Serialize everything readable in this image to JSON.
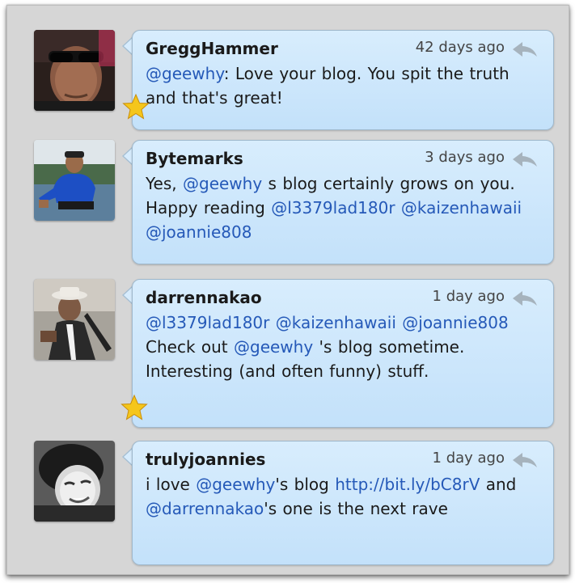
{
  "tweets": [
    {
      "username": "GreggHammer",
      "time": "42 days ago",
      "segments": [
        {
          "type": "mention",
          "text": "@geewhy"
        },
        {
          "type": "text",
          "text": ": Love your blog. You spit the truth and that's great!"
        }
      ],
      "starred": true
    },
    {
      "username": "Bytemarks",
      "time": "3 days ago",
      "segments": [
        {
          "type": "text",
          "text": "Yes, "
        },
        {
          "type": "mention",
          "text": "@geewhy"
        },
        {
          "type": "text",
          "text": " s blog certainly grows on you. Happy reading "
        },
        {
          "type": "mention",
          "text": "@l3379lad180r"
        },
        {
          "type": "text",
          "text": " "
        },
        {
          "type": "mention",
          "text": "@kaizenhawaii"
        },
        {
          "type": "text",
          "text": " "
        },
        {
          "type": "mention",
          "text": "@joannie808"
        }
      ],
      "starred": false
    },
    {
      "username": "darrennakao",
      "time": "1 day ago",
      "segments": [
        {
          "type": "mention",
          "text": "@l3379lad180r"
        },
        {
          "type": "text",
          "text": " "
        },
        {
          "type": "mention",
          "text": "@kaizenhawaii"
        },
        {
          "type": "text",
          "text": " "
        },
        {
          "type": "mention",
          "text": "@joannie808"
        },
        {
          "type": "text",
          "text": " Check out "
        },
        {
          "type": "mention",
          "text": "@geewhy"
        },
        {
          "type": "text",
          "text": " 's blog sometime. Interesting (and often funny) stuff."
        }
      ],
      "starred": true
    },
    {
      "username": "trulyjoannies",
      "time": "1 day ago",
      "segments": [
        {
          "type": "text",
          "text": "i love "
        },
        {
          "type": "mention",
          "text": "@geewhy"
        },
        {
          "type": "text",
          "text": "'s blog  "
        },
        {
          "type": "link",
          "text": "http://bit.ly/bC8rV"
        },
        {
          "type": "text",
          "text": " and "
        },
        {
          "type": "mention",
          "text": "@darrennakao"
        },
        {
          "type": "text",
          "text": "'s one is the next rave"
        }
      ],
      "starred": false
    }
  ],
  "icons": {
    "reply": "reply-arrow-icon",
    "star": "favorite-star-icon"
  },
  "colors": {
    "bubble": "#cfe7fb",
    "mention": "#2559b8",
    "star": "#f5c61b"
  }
}
